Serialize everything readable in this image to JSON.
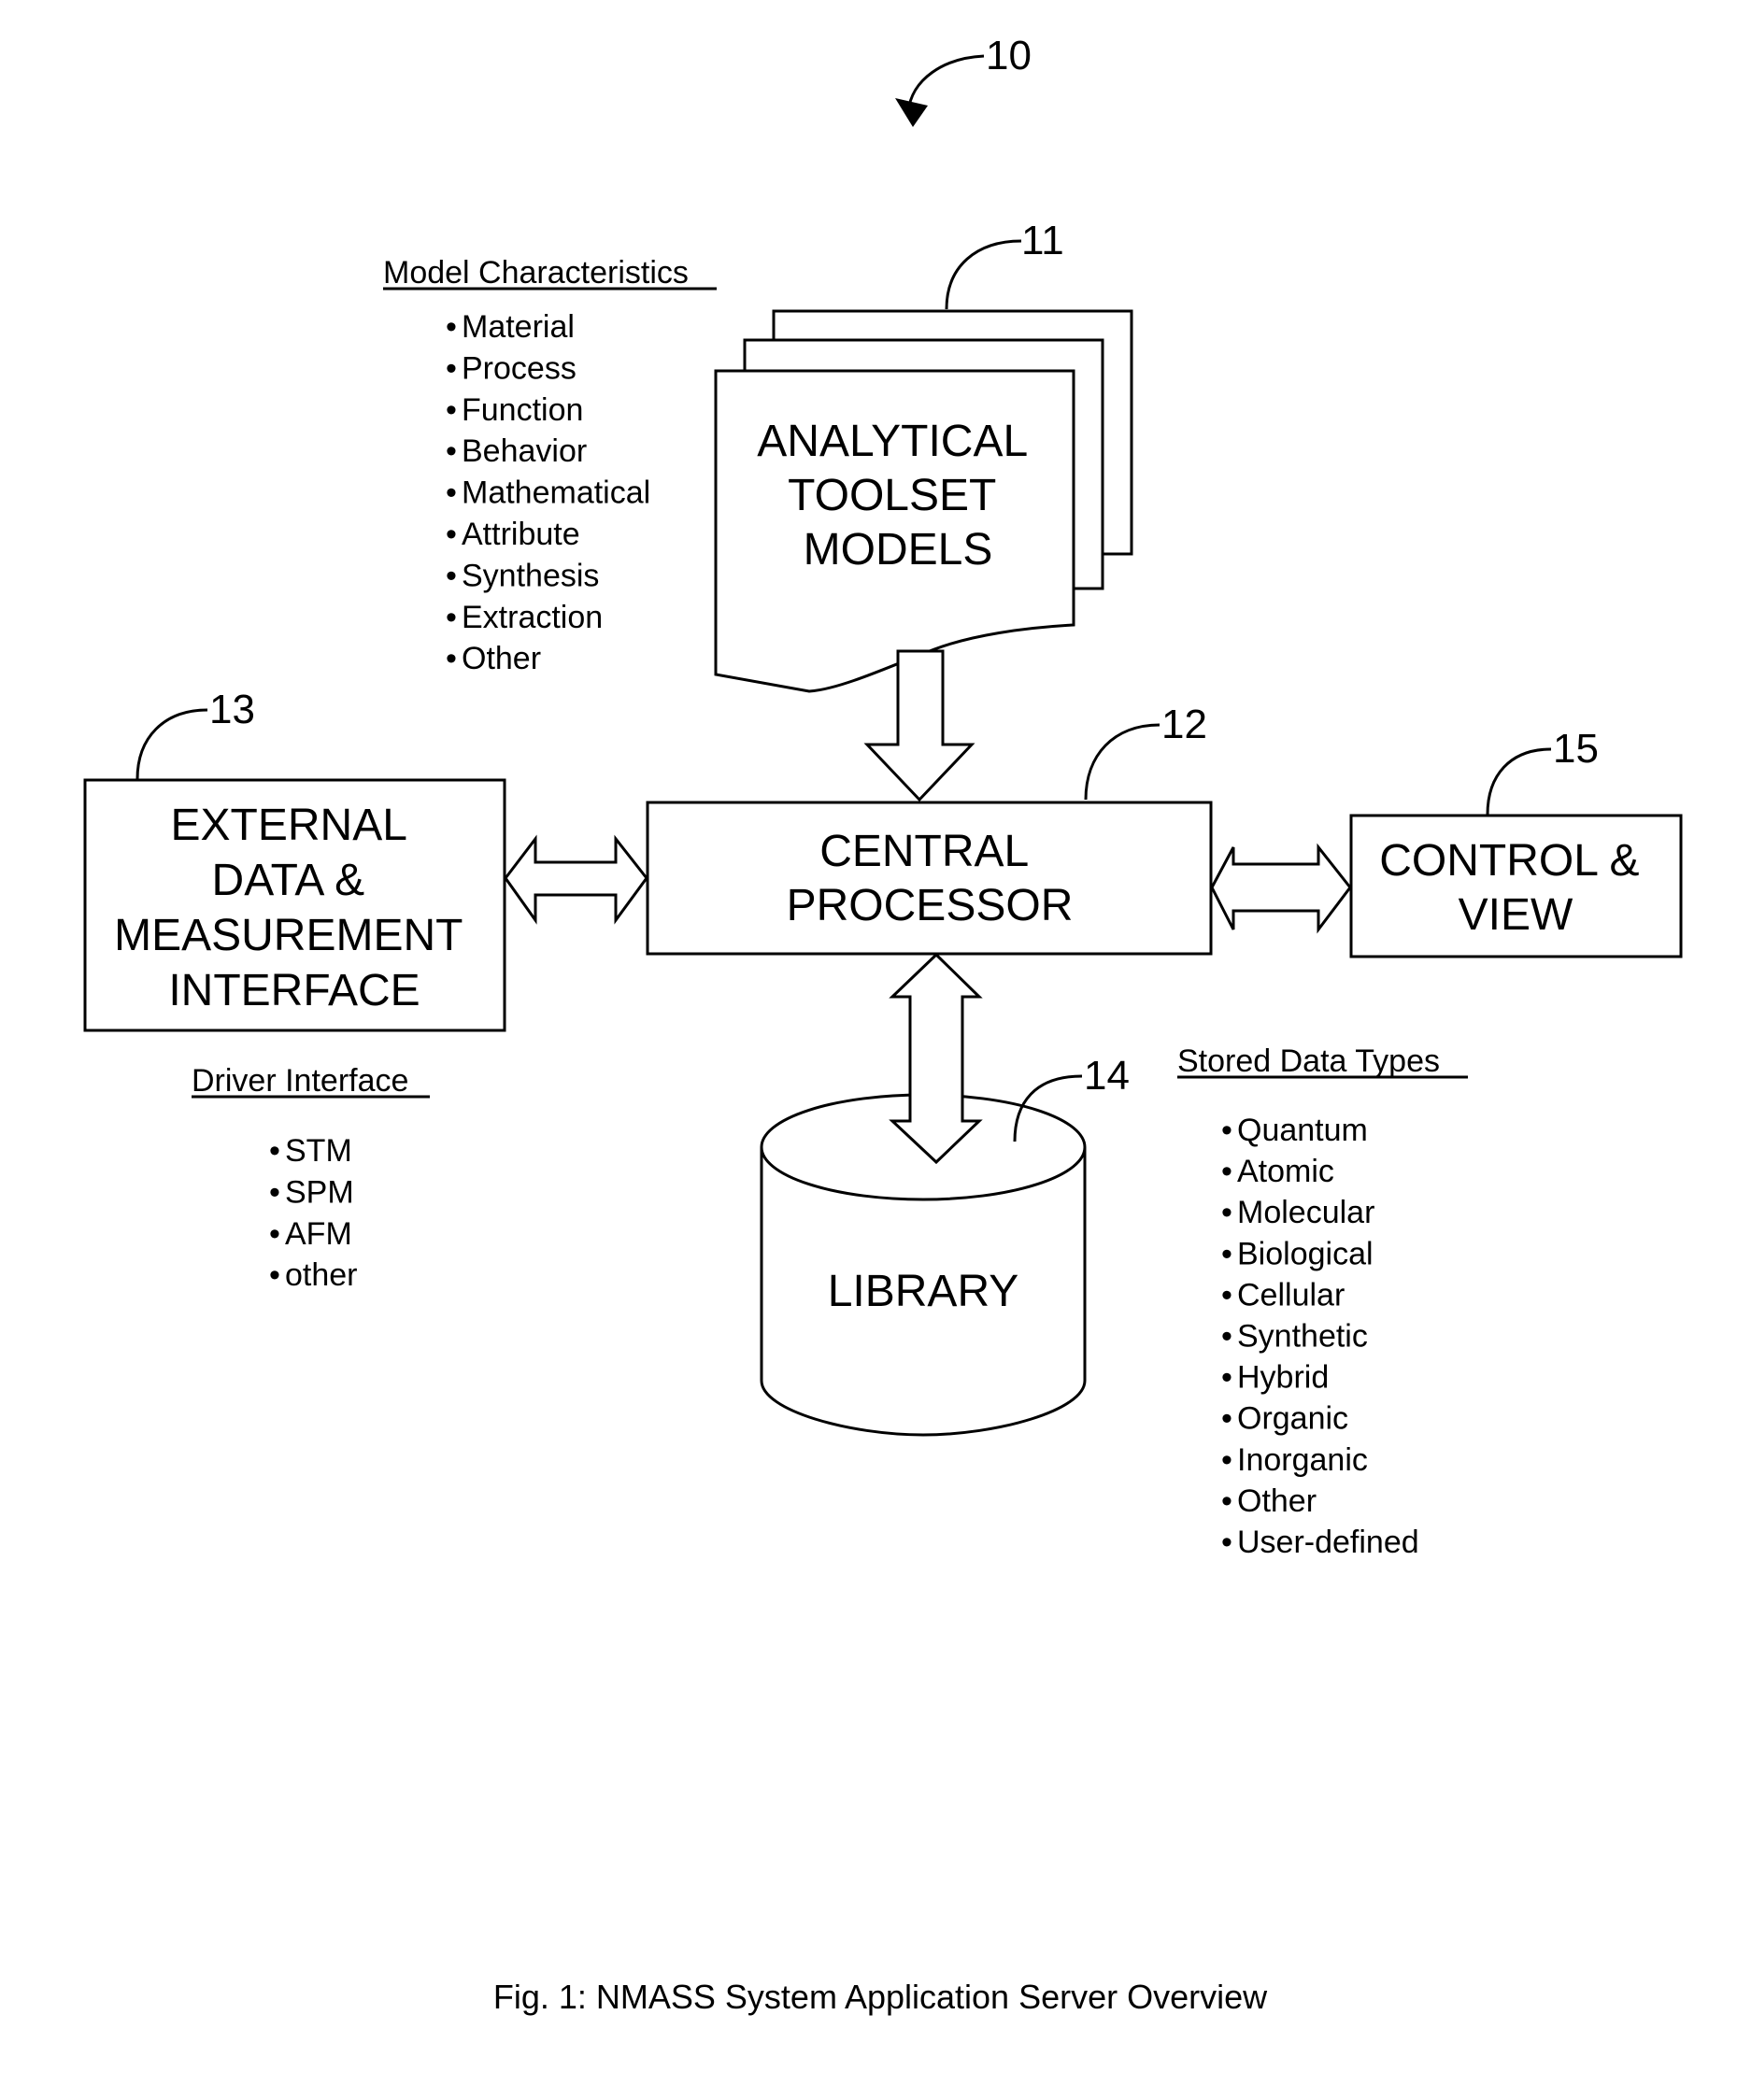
{
  "figure": {
    "reference_number": "10",
    "caption": "Fig. 1: NMASS System Application Server Overview"
  },
  "components": {
    "analytical_toolset": {
      "ref": "11",
      "lines": [
        "ANALYTICAL",
        "TOOLSET",
        "MODELS"
      ]
    },
    "central_processor": {
      "ref": "12",
      "lines": [
        "CENTRAL",
        "PROCESSOR"
      ]
    },
    "external_interface": {
      "ref": "13",
      "lines": [
        "EXTERNAL",
        "DATA &",
        "MEASUREMENT",
        "INTERFACE"
      ]
    },
    "library": {
      "ref": "14",
      "label": "LIBRARY"
    },
    "control_view": {
      "ref": "15",
      "lines": [
        "CONTROL &",
        "VIEW"
      ]
    }
  },
  "lists": {
    "model_characteristics": {
      "title": "Model Characteristics",
      "items": [
        "Material",
        "Process",
        "Function",
        "Behavior",
        "Mathematical",
        "Attribute",
        "Synthesis",
        "Extraction",
        "Other"
      ]
    },
    "driver_interface": {
      "title": "Driver Interface",
      "items": [
        "STM",
        "SPM",
        "AFM",
        "other"
      ]
    },
    "stored_data_types": {
      "title": "Stored Data Types",
      "items": [
        "Quantum",
        "Atomic",
        "Molecular",
        "Biological",
        "Cellular",
        "Synthetic",
        "Hybrid",
        "Organic",
        "Inorganic",
        "Other",
        "User-defined"
      ]
    }
  },
  "bullet": "•"
}
